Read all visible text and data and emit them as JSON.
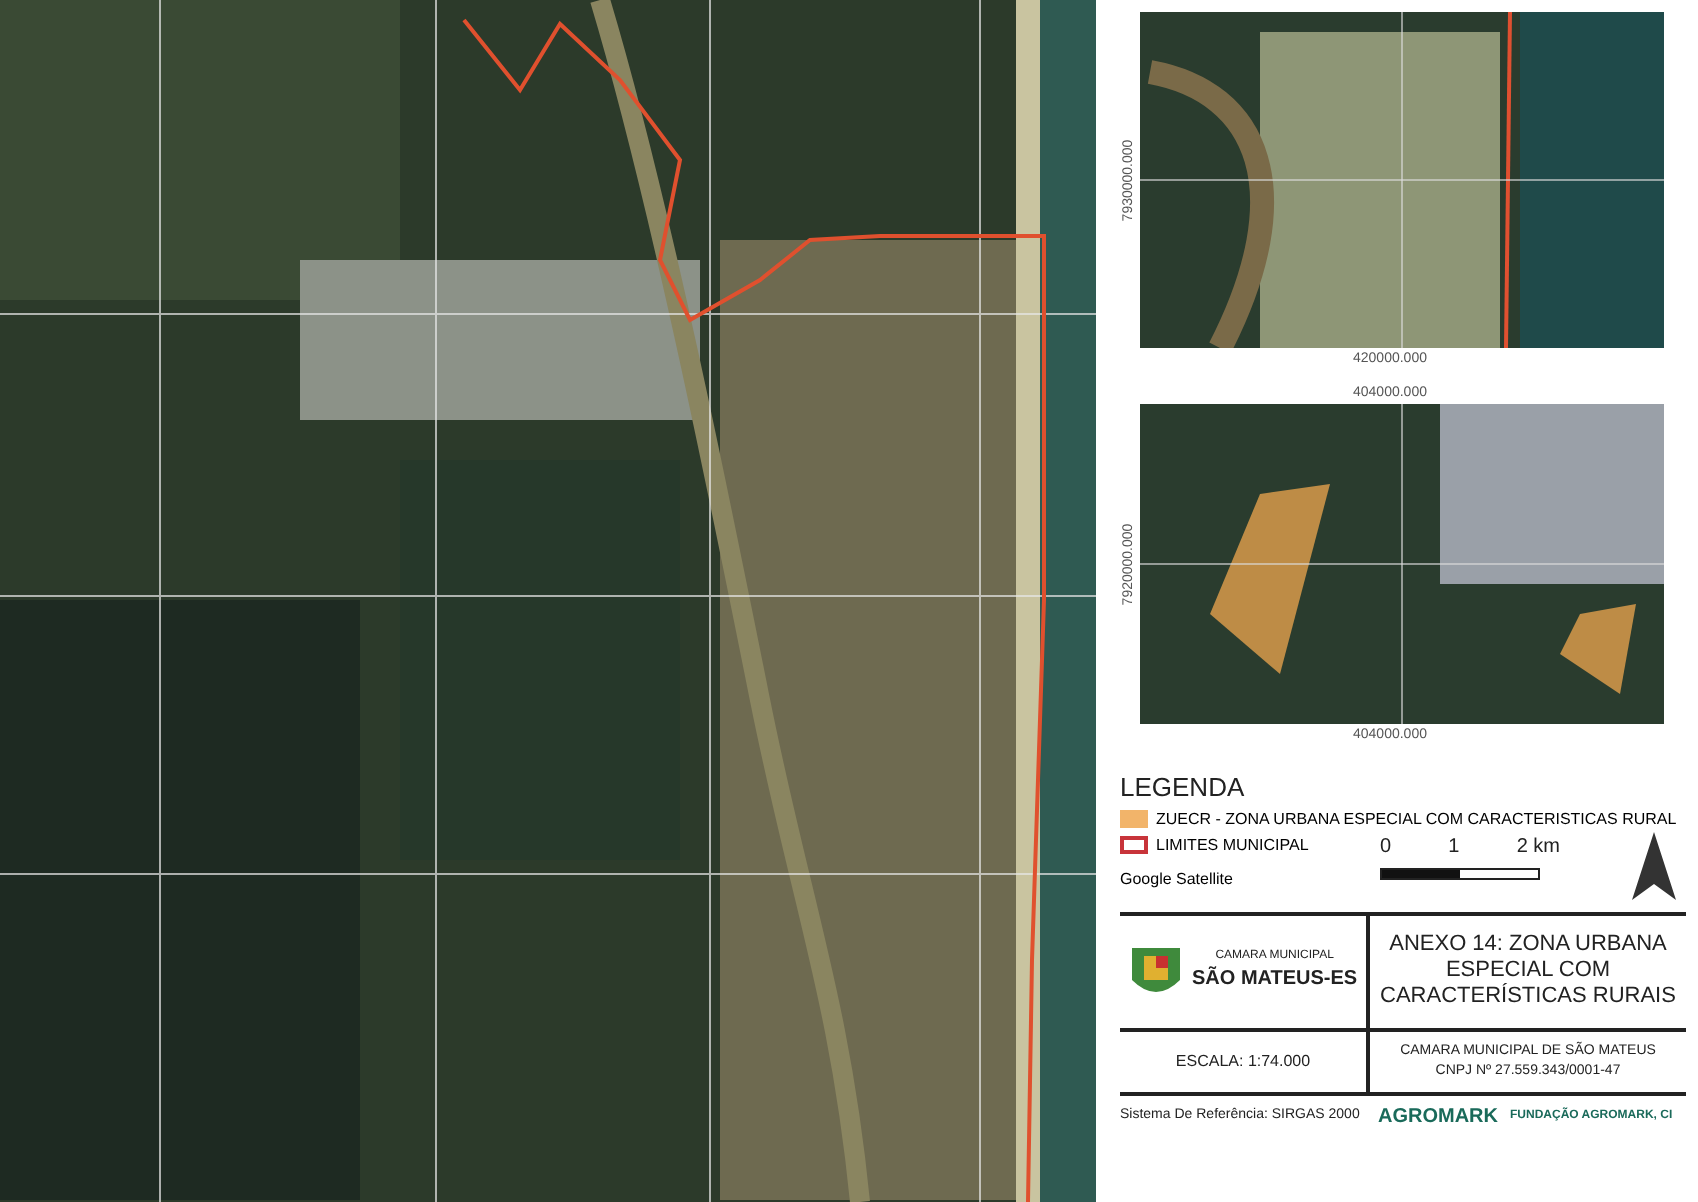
{
  "inset_maps": [
    {
      "bottom_label": "420000.000",
      "side_label": "7930000.000",
      "kind": "coast"
    },
    {
      "top_label": "404000.000",
      "bottom_label": "404000.000",
      "side_label": "7920000.000",
      "kind": "zones"
    }
  ],
  "legend": {
    "title": "LEGENDA",
    "items": [
      {
        "kind": "fill",
        "color": "#f2b46a",
        "label": "ZUECR - ZONA URBANA ESPECIAL COM CARACTERISTICAS RURAL"
      },
      {
        "kind": "outline",
        "color": "#c8343a",
        "label": "LIMITES MUNICIPAL"
      },
      {
        "kind": "text",
        "label": "Google Satellite"
      }
    ],
    "scale_labels": [
      "0",
      "1",
      "2 km"
    ]
  },
  "title_block": {
    "org_small": "CAMARA MUNICIPAL",
    "org_name": "SÃO MATEUS-ES",
    "title": "ANEXO 14: ZONA URBANA ESPECIAL COM CARACTERÍSTICAS RURAIS",
    "scale": "ESCALA: 1:74.000",
    "issuer": "CAMARA MUNICIPAL DE SÃO MATEUS",
    "cnpj": "CNPJ Nº 27.559.343/0001-47",
    "reference": "Sistema De Referência: SIRGAS 2000",
    "brand": "AGROMARK",
    "foundation": "FUNDAÇÃO AGROMARK, CI"
  }
}
